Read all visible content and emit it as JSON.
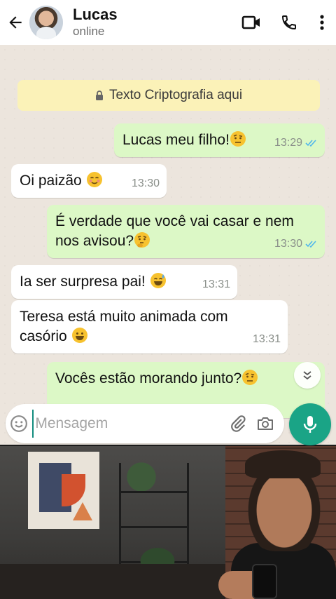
{
  "header": {
    "back_icon": "arrow-left-icon",
    "avatar": "contact-avatar",
    "name": "Lucas",
    "status": "online",
    "actions": [
      "video-call-icon",
      "phone-icon",
      "more-vert-icon"
    ]
  },
  "chat": {
    "encryption_notice": "Texto Criptografia aqui",
    "messages": [
      {
        "dir": "out",
        "text": "Lucas meu filho!",
        "emoji": "raised-eyebrow",
        "time": "13:29",
        "read": true
      },
      {
        "dir": "in",
        "text": "Oi paizão",
        "emoji": "smiling-blush",
        "time": "13:30"
      },
      {
        "dir": "out",
        "text": "É verdade que você vai casar e nem nos avisou?",
        "emoji": "thinking",
        "time": "13:30",
        "read": true
      },
      {
        "dir": "in",
        "text": "Ia ser surpresa pai!",
        "emoji": "grinning-sweat",
        "time": "13:31"
      },
      {
        "dir": "in",
        "text": "Teresa está muito animada com casório",
        "emoji": "grinning",
        "time": "13:31"
      },
      {
        "dir": "out",
        "text": "Vocês estão morando junto?",
        "emoji": "raised-eyebrow"
      }
    ]
  },
  "input": {
    "placeholder": "Mensagem",
    "icons": [
      "emoji-icon",
      "attach-icon",
      "camera-icon",
      "mic-icon"
    ]
  },
  "colors": {
    "outgoing_bubble": "#dcf8c6",
    "incoming_bubble": "#ffffff",
    "encryption_banner": "#fbf2b8",
    "accent": "#1aa486",
    "read_ticks": "#4fb6ec"
  }
}
